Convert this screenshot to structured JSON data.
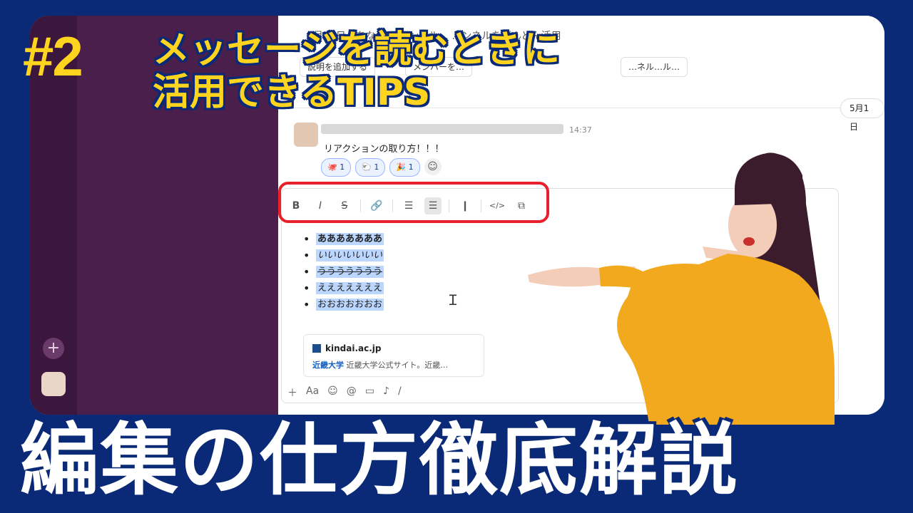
{
  "badge": "#2",
  "subtitle": [
    "メッセージを読むときに",
    "活用できるTIPS"
  ],
  "main_title": "編集の仕方徹底解説",
  "app": {
    "header_text": "4月26日、あな… …ャンネル… …ンネルをどんどん活用",
    "chips": [
      "説明を追加する",
      "メンバーを…",
      "…ネル…ル…"
    ],
    "date_divider": "5月1日",
    "message": {
      "time": "14:37",
      "text": "リアクションの取り方！！！",
      "reactions": [
        {
          "icon": "🐙",
          "count": "1"
        },
        {
          "icon": "🐑",
          "count": "1"
        },
        {
          "icon": "🎉",
          "count": "1"
        }
      ]
    },
    "toolbar": [
      {
        "name": "bold-icon",
        "glyph": "B"
      },
      {
        "name": "italic-icon",
        "glyph": "I"
      },
      {
        "name": "strikethrough-icon",
        "glyph": "S"
      },
      {
        "name": "link-icon",
        "glyph": "🔗"
      },
      {
        "name": "ordered-list-icon",
        "glyph": "☰"
      },
      {
        "name": "bulleted-list-icon",
        "glyph": "☰"
      },
      {
        "name": "blockquote-icon",
        "glyph": "❙"
      },
      {
        "name": "code-icon",
        "glyph": "</>"
      },
      {
        "name": "code-block-icon",
        "glyph": "⧉"
      }
    ],
    "bullets": [
      "あああああああ",
      "いいいいいいい",
      "ううううううう",
      "えええええええ",
      "おおおおおおお"
    ],
    "link_preview": {
      "site": "kindai.ac.jp",
      "title": "近畿大学",
      "desc": "近畿大学公式サイト。近畿…"
    },
    "colors": {
      "accent_highlight": "#e8202a",
      "brand_bg": "#0a2a78",
      "badge": "#ffd41e"
    }
  }
}
